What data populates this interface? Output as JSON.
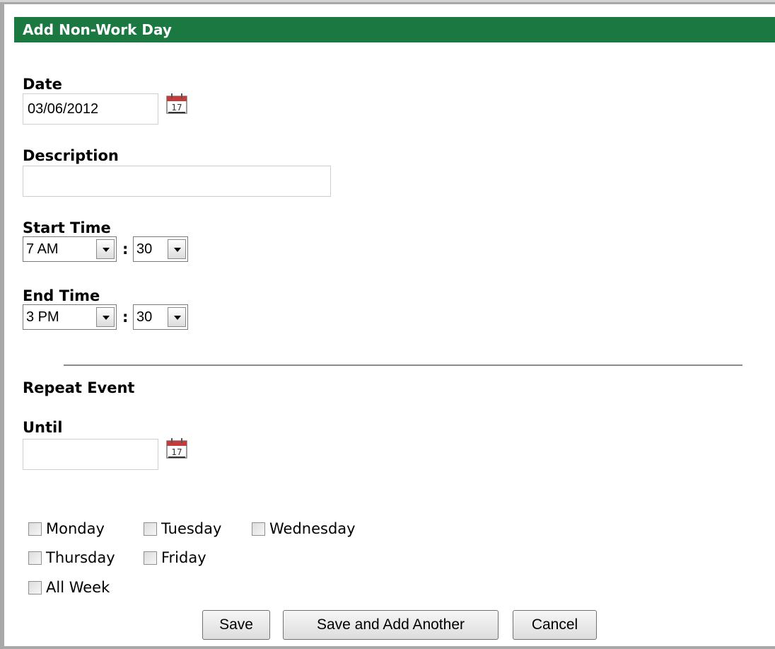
{
  "dialog": {
    "title": "Add Non-Work Day"
  },
  "date": {
    "label": "Date",
    "value": "03/06/2012",
    "icon": "calendar-icon"
  },
  "description": {
    "label": "Description",
    "value": ""
  },
  "start_time": {
    "label": "Start Time",
    "hour": "7 AM",
    "minute": "30"
  },
  "end_time": {
    "label": "End Time",
    "hour": "3 PM",
    "minute": "30"
  },
  "time_separator": ":",
  "repeat": {
    "heading": "Repeat Event",
    "until_label": "Until",
    "until_value": "",
    "days": [
      "Monday",
      "Tuesday",
      "Wednesday",
      "Thursday",
      "Friday",
      "All Week"
    ]
  },
  "buttons": {
    "save": "Save",
    "save_add": "Save and Add Another",
    "cancel": "Cancel"
  },
  "colors": {
    "titlebar": "#1b7841",
    "border": "#a8a8a8"
  }
}
